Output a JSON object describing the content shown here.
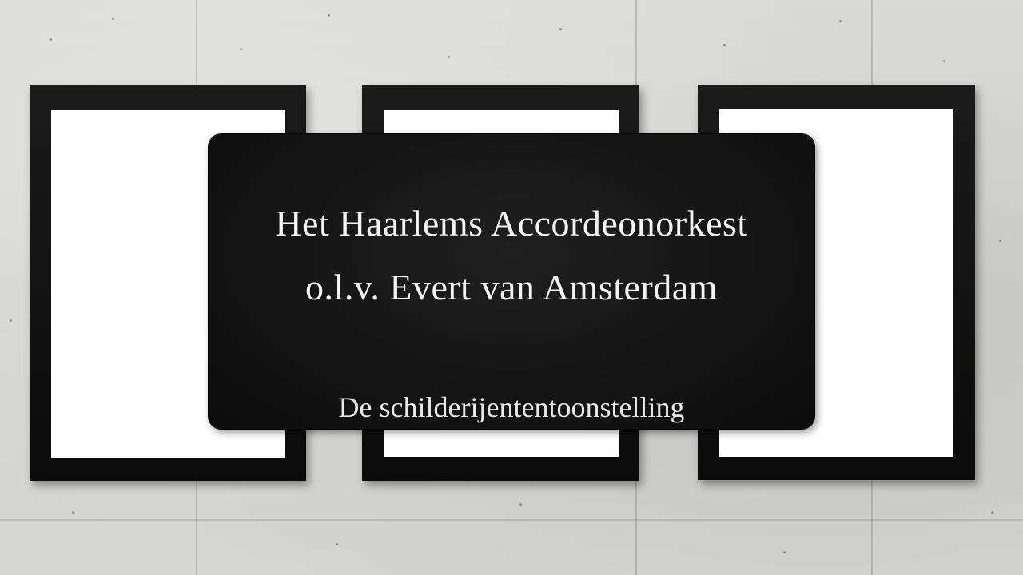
{
  "slide": {
    "title_line_1": "Het Haarlems Accordeonorkest",
    "title_line_2": "o.l.v. Evert van Amsterdam",
    "subtitle": "De schilderijententoonstelling"
  },
  "colors": {
    "wall": "#d4d4d1",
    "frame": "#111111",
    "mat": "#ffffff",
    "panel": "#141414",
    "text": "#f4f4f4"
  }
}
